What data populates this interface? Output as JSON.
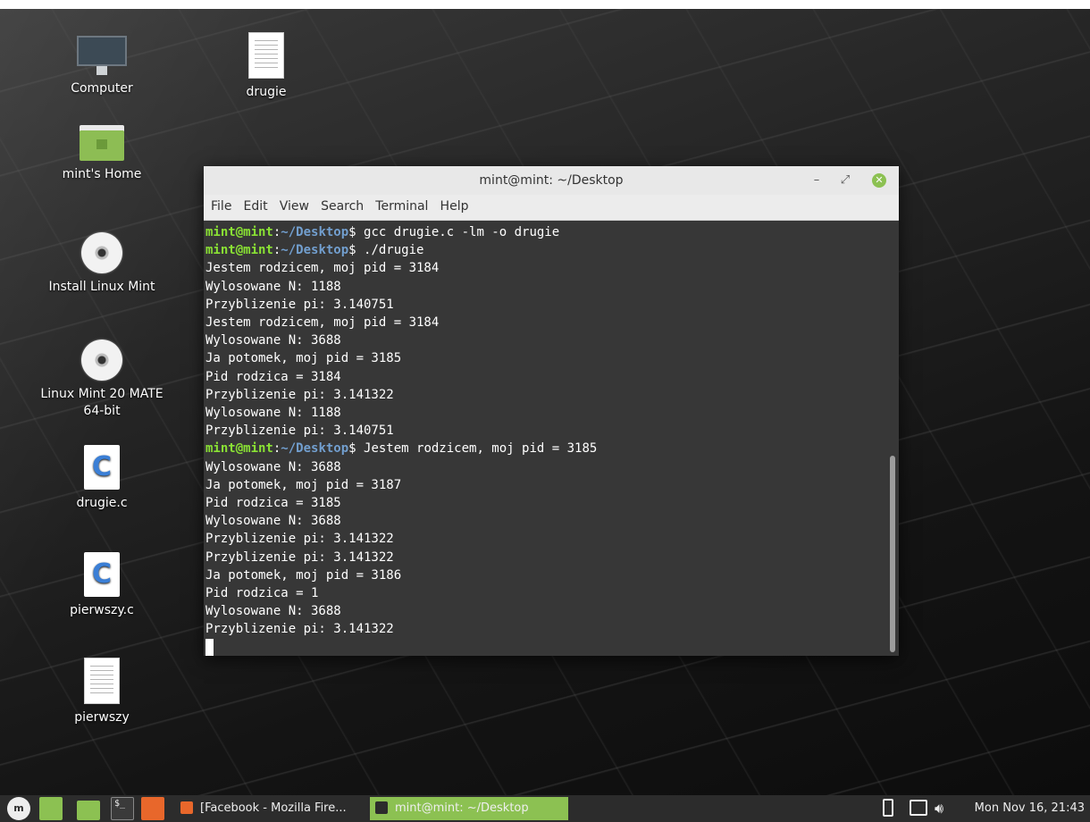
{
  "desktop": {
    "icons": {
      "computer": "Computer",
      "home": "mint's Home",
      "install": "Install Linux Mint",
      "dvd_line1": "Linux Mint 20 MATE",
      "dvd_line2": "64-bit",
      "drugie_c": "drugie.c",
      "pierwszy_c": "pierwszy.c",
      "pierwszy": "pierwszy",
      "drugie": "drugie"
    }
  },
  "terminal": {
    "title": "mint@mint: ~/Desktop",
    "controls": {
      "minimize": "–",
      "maximize": "⤢",
      "close": "✕"
    },
    "menu": [
      "File",
      "Edit",
      "View",
      "Search",
      "Terminal",
      "Help"
    ],
    "prompt": {
      "user": "mint@mint",
      "sep": ":",
      "path": "~/Desktop",
      "sign": "$ "
    },
    "lines": [
      {
        "prompt": true,
        "text": "gcc drugie.c -lm -o drugie"
      },
      {
        "prompt": true,
        "text": "./drugie"
      },
      {
        "prompt": false,
        "text": "Jestem rodzicem, moj pid = 3184"
      },
      {
        "prompt": false,
        "text": "Wylosowane N: 1188"
      },
      {
        "prompt": false,
        "text": "Przyblizenie pi: 3.140751"
      },
      {
        "prompt": false,
        "text": "Jestem rodzicem, moj pid = 3184"
      },
      {
        "prompt": false,
        "text": "Wylosowane N: 3688"
      },
      {
        "prompt": false,
        "text": "Ja potomek, moj pid = 3185"
      },
      {
        "prompt": false,
        "text": "Pid rodzica = 3184"
      },
      {
        "prompt": false,
        "text": "Przyblizenie pi: 3.141322"
      },
      {
        "prompt": false,
        "text": "Wylosowane N: 1188"
      },
      {
        "prompt": false,
        "text": "Przyblizenie pi: 3.140751"
      },
      {
        "prompt": true,
        "text": "Jestem rodzicem, moj pid = 3185"
      },
      {
        "prompt": false,
        "text": "Wylosowane N: 3688"
      },
      {
        "prompt": false,
        "text": "Ja potomek, moj pid = 3187"
      },
      {
        "prompt": false,
        "text": "Pid rodzica = 3185"
      },
      {
        "prompt": false,
        "text": "Wylosowane N: 3688"
      },
      {
        "prompt": false,
        "text": "Przyblizenie pi: 3.141322"
      },
      {
        "prompt": false,
        "text": "Przyblizenie pi: 3.141322"
      },
      {
        "prompt": false,
        "text": "Ja potomek, moj pid = 3186"
      },
      {
        "prompt": false,
        "text": "Pid rodzica = 1"
      },
      {
        "prompt": false,
        "text": "Wylosowane N: 3688"
      },
      {
        "prompt": false,
        "text": "Przyblizenie pi: 3.141322"
      }
    ]
  },
  "taskbar": {
    "mint_menu": "m",
    "terminal_glyph": "$_",
    "tasks": {
      "firefox": "[Facebook - Mozilla Fire...",
      "terminal": "mint@mint: ~/Desktop"
    },
    "clock": "Mon Nov 16, 21:43",
    "colors": {
      "active_task": "#8cc152",
      "panel": "#2c2c2c",
      "accent_green": "#8cc152",
      "firefox": "#e8672b"
    }
  }
}
